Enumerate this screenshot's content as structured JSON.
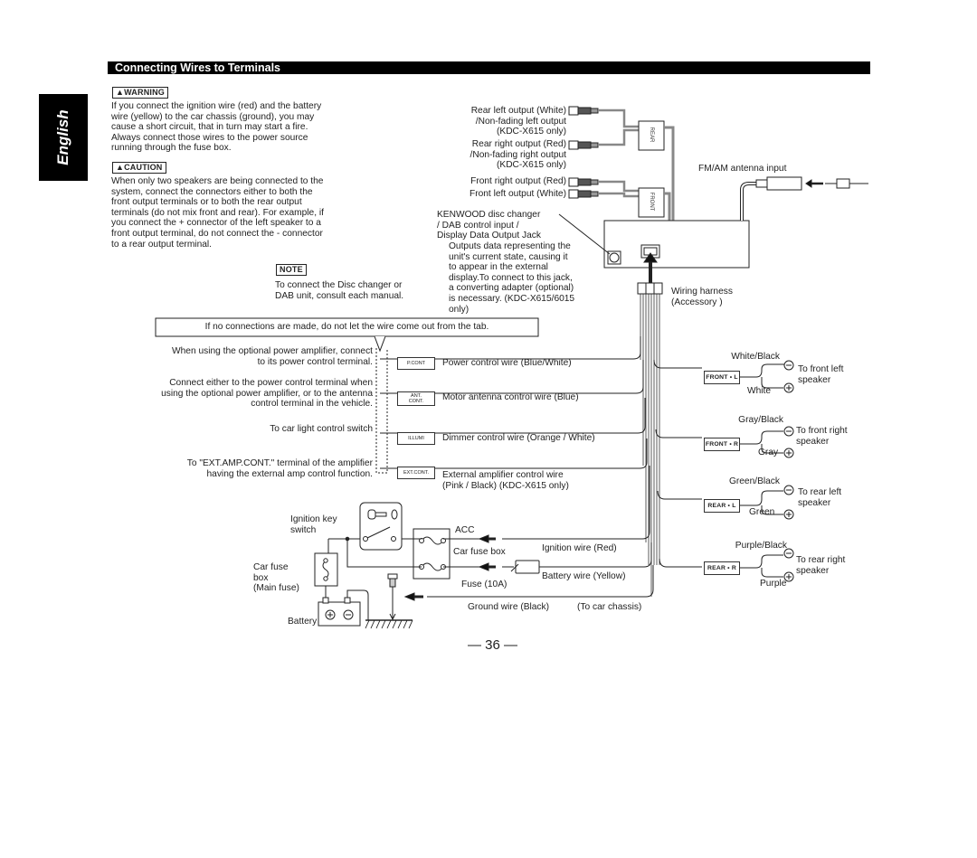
{
  "section": {
    "title": "Connecting Wires to Terminals",
    "language_tab": "English",
    "page_number": "— 36 —"
  },
  "warning": {
    "label": "▲WARNING",
    "text": "If you connect the ignition wire (red) and the battery\nwire (yellow) to the car chassis (ground), you may\ncause a short circuit, that in turn may start a fire.\nAlways connect those wires to the power source\nrunning through the fuse box."
  },
  "caution": {
    "label": "▲CAUTION",
    "text": "When only two speakers are being connected to the\nsystem, connect the connectors either to both the\nfront output terminals or to both the rear output\nterminals (do not mix front and rear). For example, if\nyou connect the + connector of the left speaker to a\nfront output terminal, do not connect the - connector\nto a rear output terminal."
  },
  "note": {
    "label": "NOTE",
    "text": "To connect the Disc changer or\nDAB unit, consult each manual."
  },
  "outputs": {
    "rear_left": "Rear left output (White)\n/Non-fading left output\n(KDC-X615 only)",
    "rear_right": "Rear right output (Red)\n/Non-fading right output\n(KDC-X615 only)",
    "front_right": "Front right output (Red)",
    "front_left": "Front left output (White)",
    "rear_block_label": "REAR",
    "front_block_label": "FRONT"
  },
  "disc_changer": {
    "title": "KENWOOD disc changer\n/ DAB control input /\nDisplay Data Output Jack",
    "desc": "Outputs data representing the\nunit's current state, causing it\nto appear in the external\ndisplay.To connect to this jack,\na converting adapter (optional)\nis necessary. (KDC-X615/6015\nonly)"
  },
  "antenna": {
    "label": "FM/AM antenna input"
  },
  "harness": {
    "label": "Wiring harness\n(Accessory    )"
  },
  "tab_notice": "If no connections are made, do not let the wire come out from the tab.",
  "control_wires": [
    {
      "tag": "P.CONT",
      "label": "Power control wire (Blue/White)",
      "note": "When using the optional power amplifier, connect\nto its power control terminal."
    },
    {
      "tag": "ANT.\nCONT.",
      "label": "Motor antenna control wire (Blue)",
      "note": "Connect either to the power control terminal when\nusing the optional power amplifier, or to the antenna\ncontrol terminal in the vehicle."
    },
    {
      "tag": "ILLUMI",
      "label": "Dimmer control wire (Orange / White)",
      "note": "To car light control switch"
    },
    {
      "tag": "EXT.CONT.",
      "label": "External amplifier control wire\n(Pink / Black) (KDC-X615 only)",
      "note": "To \"EXT.AMP.CONT.\" terminal of the amplifier\nhaving the external amp control function."
    }
  ],
  "speakers": [
    {
      "tag": "FRONT • L",
      "neg": "White/Black",
      "pos": "White",
      "target": "To front left\nspeaker"
    },
    {
      "tag": "FRONT • R",
      "neg": "Gray/Black",
      "pos": "Gray",
      "target": "To front right\nspeaker"
    },
    {
      "tag": "REAR • L",
      "neg": "Green/Black",
      "pos": "Green",
      "target": "To rear left\nspeaker"
    },
    {
      "tag": "REAR • R",
      "neg": "Purple/Black",
      "pos": "Purple",
      "target": "To rear right\nspeaker"
    }
  ],
  "power": {
    "ignition_key": "Ignition key\nswitch",
    "car_fuse": "Car fuse\nbox\n(Main fuse)",
    "battery": "Battery",
    "acc": "ACC",
    "car_fuse_box": "Car fuse box",
    "fuse": "Fuse (10A)",
    "ignition_wire": "Ignition wire (Red)",
    "battery_wire": "Battery wire (Yellow)",
    "ground_wire": "Ground wire (Black)",
    "chassis": "(To car chassis)"
  },
  "symbols": {
    "minus": "−",
    "plus": "+"
  }
}
